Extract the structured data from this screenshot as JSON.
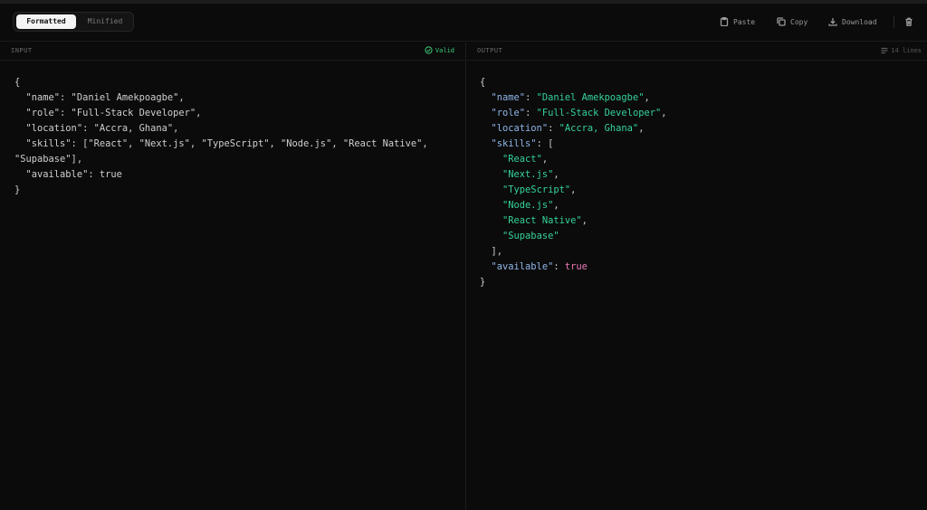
{
  "toolbar": {
    "modes": [
      {
        "label": "Formatted",
        "active": true
      },
      {
        "label": "Minified",
        "active": false
      }
    ],
    "paste_label": "Paste",
    "copy_label": "Copy",
    "download_label": "Download"
  },
  "input": {
    "title": "INPUT",
    "status": "Valid",
    "lines": [
      "{",
      "  \"name\": \"Daniel Amekpoagbe\",",
      "  \"role\": \"Full-Stack Developer\",",
      "  \"location\": \"Accra, Ghana\",",
      "  \"skills\": [\"React\", \"Next.js\", \"TypeScript\", \"Node.js\", \"React Native\",",
      "\"Supabase\"],",
      "  \"available\": true",
      "}"
    ]
  },
  "output": {
    "title": "OUTPUT",
    "line_count": "14 lines",
    "lines": [
      "{",
      "  \"name\": \"Daniel Amekpoagbe\",",
      "  \"role\": \"Full-Stack Developer\",",
      "  \"location\": \"Accra, Ghana\",",
      "  \"skills\": [",
      "    \"React\",",
      "    \"Next.js\",",
      "    \"TypeScript\",",
      "    \"Node.js\",",
      "    \"React Native\",",
      "    \"Supabase\"",
      "  ],",
      "  \"available\": true",
      "}"
    ]
  },
  "colors": {
    "background": "#0b0b0b",
    "key": "#8fb6e8",
    "string": "#34d399",
    "boolean": "#e879b5",
    "valid": "#3ecf7a"
  },
  "icons": [
    "paste-icon",
    "copy-icon",
    "download-icon",
    "trash-icon",
    "check-circle-icon",
    "lines-icon"
  ]
}
